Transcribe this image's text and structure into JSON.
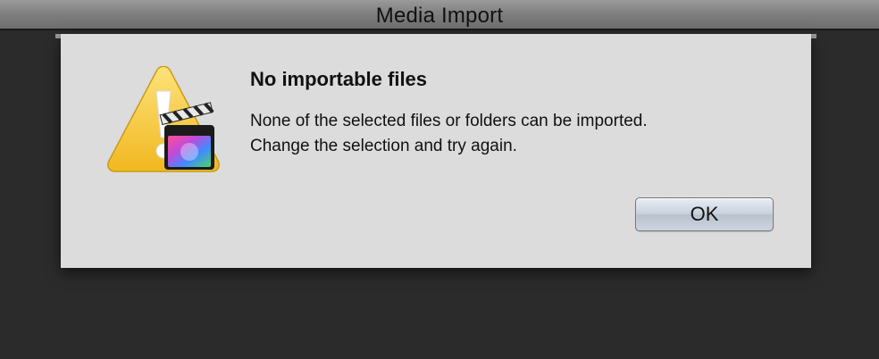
{
  "window": {
    "title": "Media Import"
  },
  "alert": {
    "icon": "warning-triangle-with-final-cut-pro-icon",
    "title": "No importable files",
    "message_lines": [
      "None of the selected files or folders can be imported.",
      "Change the selection and try again."
    ],
    "ok_label": "OK"
  },
  "colors": {
    "warning_yellow": "#f7c936",
    "sheet_background": "#dcdcdc",
    "backdrop": "#2b2b2b"
  }
}
